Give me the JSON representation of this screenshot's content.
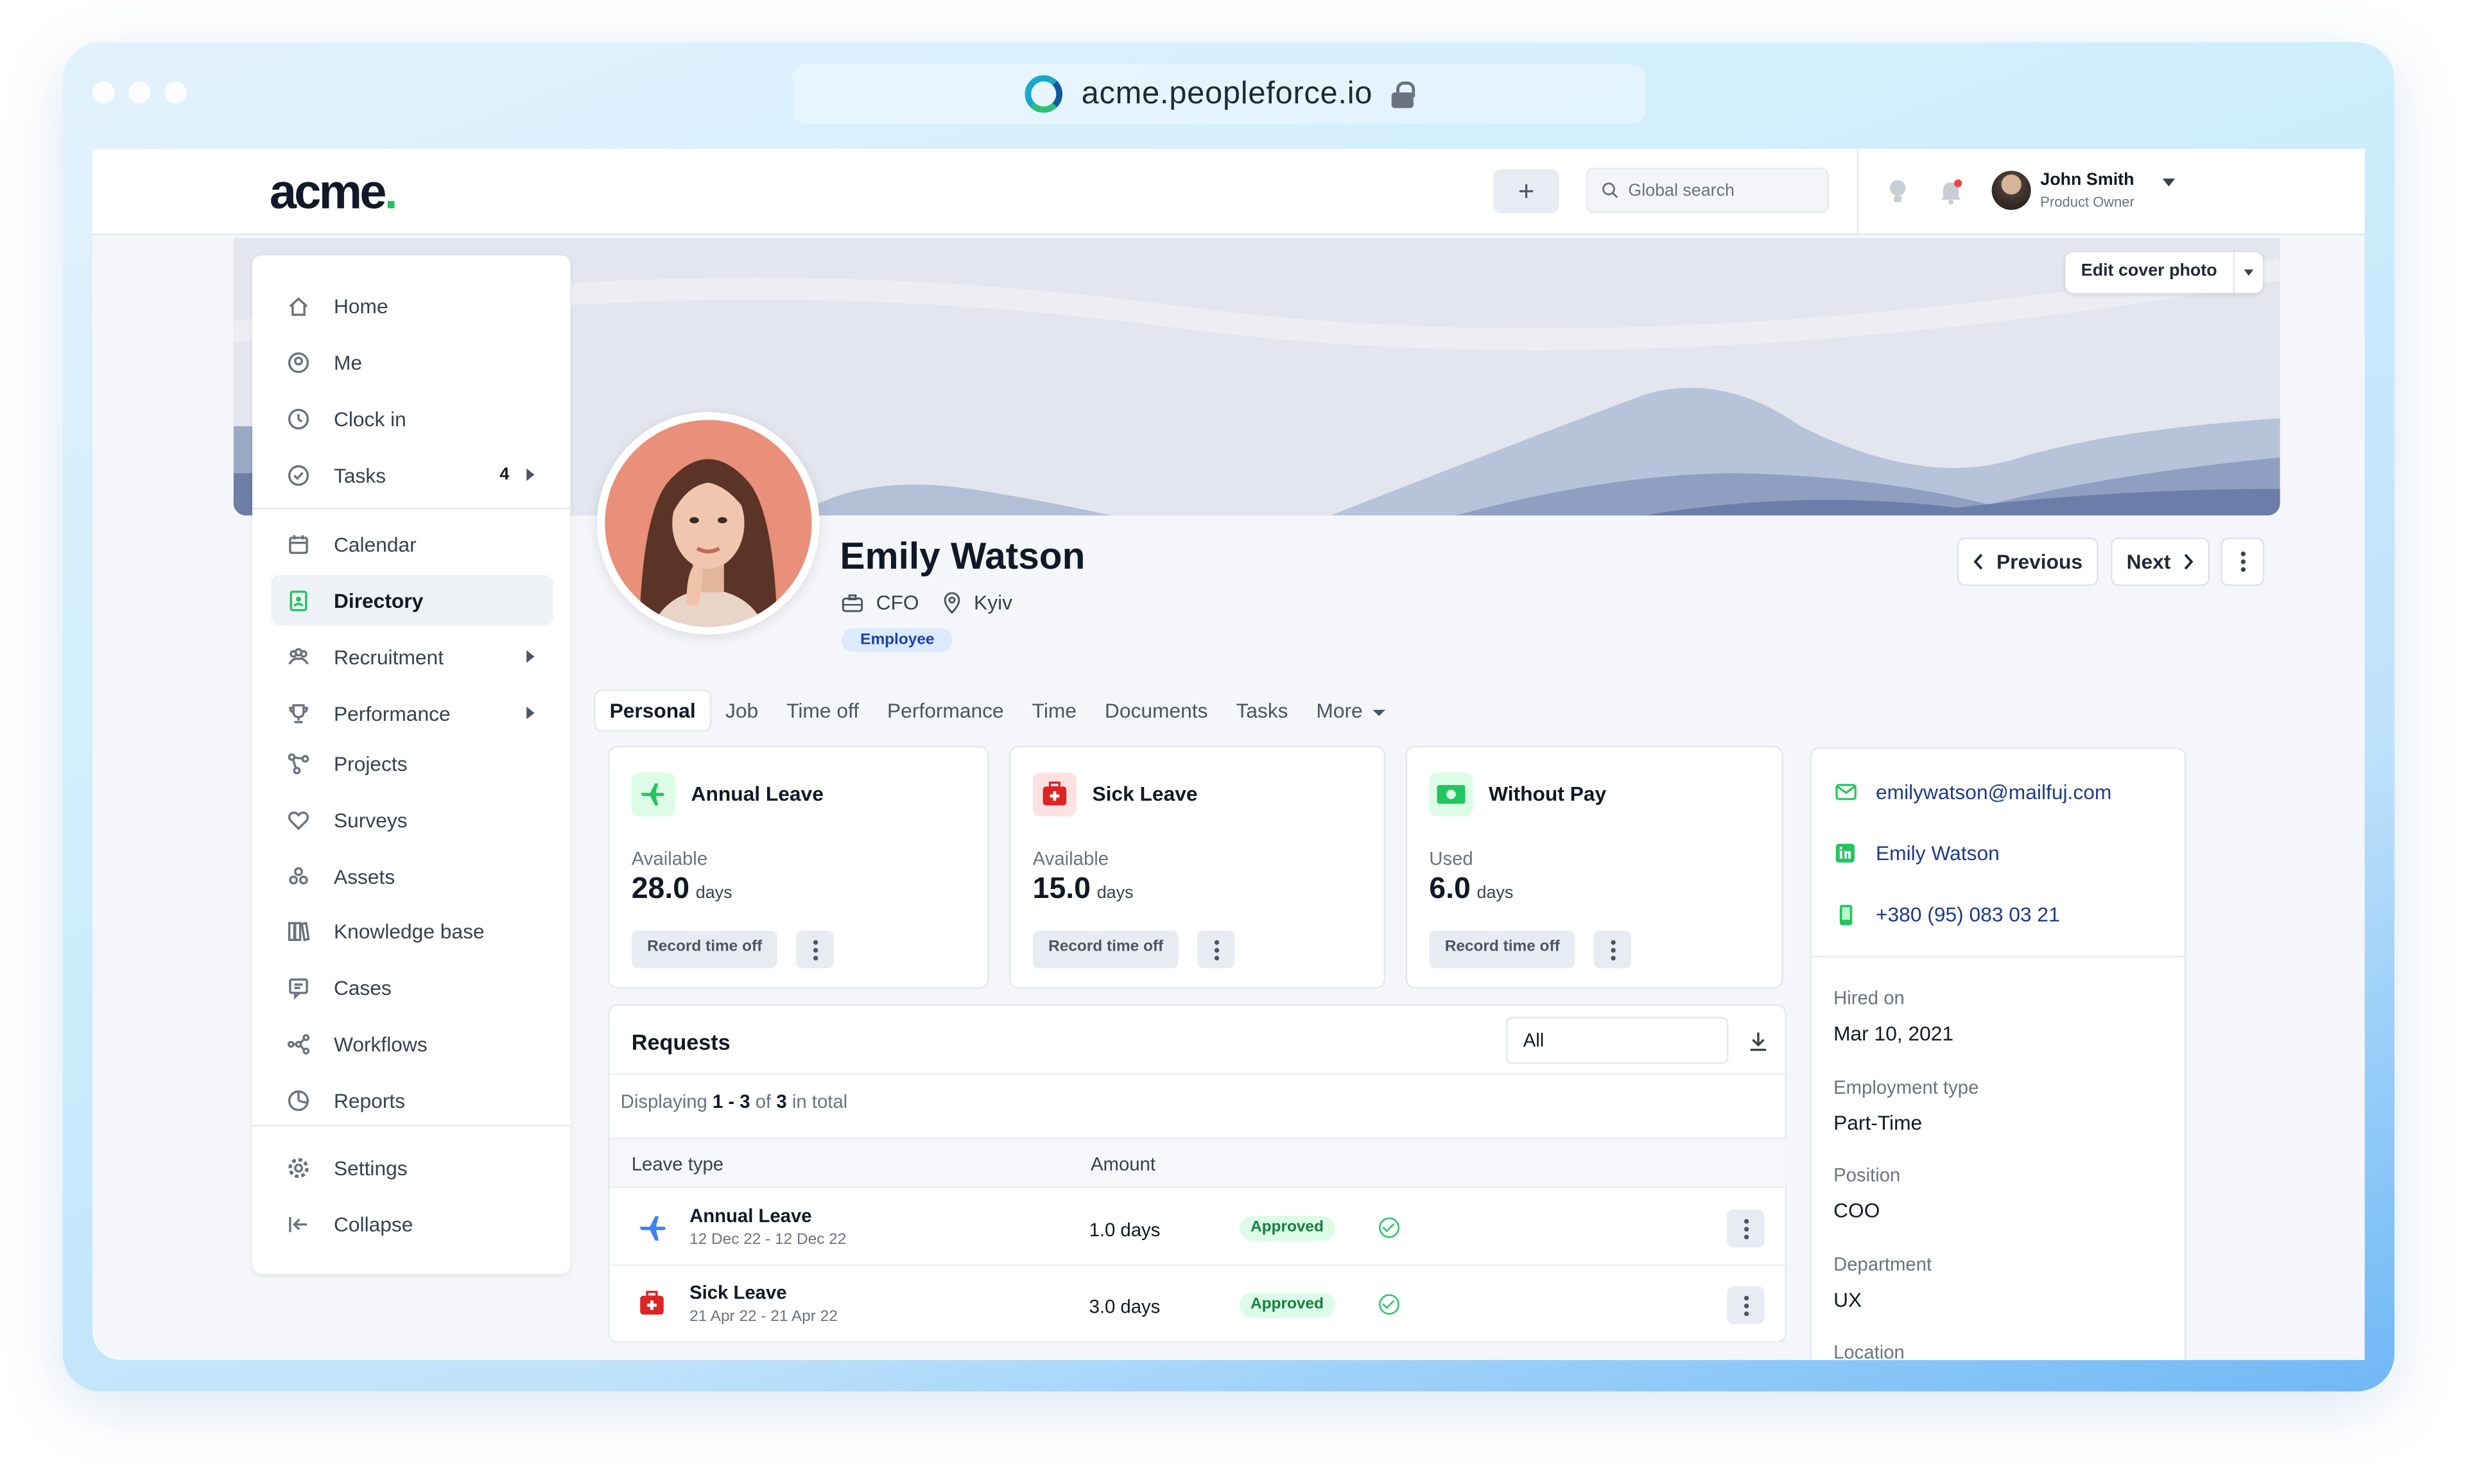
{
  "browser": {
    "url": "acme.peopleforce.io"
  },
  "topbar": {
    "brand": "acme",
    "brand_dot": ".",
    "add_label": "+",
    "search_placeholder": "Global search",
    "user": {
      "name": "John Smith",
      "role": "Product Owner"
    }
  },
  "cover": {
    "edit_label": "Edit cover photo"
  },
  "sidebar": {
    "items": [
      {
        "label": "Home",
        "icon": "home-icon"
      },
      {
        "label": "Me",
        "icon": "user-circle-icon"
      },
      {
        "label": "Clock in",
        "icon": "clock-icon"
      },
      {
        "label": "Tasks",
        "icon": "check-circle-icon",
        "badge": "4"
      },
      {
        "label": "Calendar",
        "icon": "calendar-icon"
      },
      {
        "label": "Directory",
        "icon": "directory-icon"
      },
      {
        "label": "Recruitment",
        "icon": "people-icon"
      },
      {
        "label": "Performance",
        "icon": "trophy-icon"
      },
      {
        "label": "Projects",
        "icon": "projects-icon"
      },
      {
        "label": "Surveys",
        "icon": "heart-icon"
      },
      {
        "label": "Assets",
        "icon": "assets-icon"
      },
      {
        "label": "Knowledge base",
        "icon": "books-icon"
      },
      {
        "label": "Cases",
        "icon": "chat-icon"
      },
      {
        "label": "Workflows",
        "icon": "workflow-icon"
      },
      {
        "label": "Reports",
        "icon": "pie-icon"
      },
      {
        "label": "Settings",
        "icon": "gear-icon"
      },
      {
        "label": "Collapse",
        "icon": "collapse-icon"
      }
    ]
  },
  "employee": {
    "name": "Emily Watson",
    "position": "CFO",
    "city": "Kyiv",
    "badge": "Employee",
    "prev_label": "Previous",
    "next_label": "Next"
  },
  "tabs": [
    "Personal",
    "Job",
    "Time off",
    "Performance",
    "Time",
    "Documents",
    "Tasks",
    "More"
  ],
  "leave_cards": [
    {
      "title": "Annual Leave",
      "sub": "Available",
      "value": "28.0",
      "unit": "days",
      "button": "Record time off",
      "color": "#22c55e"
    },
    {
      "title": "Sick Leave",
      "sub": "Available",
      "value": "15.0",
      "unit": "days",
      "button": "Record time off",
      "color": "#dc2626"
    },
    {
      "title": "Without Pay",
      "sub": "Used",
      "value": "6.0",
      "unit": "days",
      "button": "Record time off",
      "color": "#22c55e"
    }
  ],
  "requests": {
    "title": "Requests",
    "filter": "All",
    "displaying": "Displaying",
    "range": "1 - 3",
    "of": "of",
    "total": "3",
    "in_total": "in total",
    "columns": [
      "Leave type",
      "Amount"
    ],
    "rows": [
      {
        "type": "Annual Leave",
        "dates": "12 Dec 22 - 12 Dec 22",
        "amount": "1.0 days",
        "status": "Approved"
      },
      {
        "type": "Sick Leave",
        "dates": "21 Apr 22 - 21 Apr 22",
        "amount": "3.0 days",
        "status": "Approved"
      }
    ]
  },
  "contact": {
    "email": "emilywatson@mailfuj.com",
    "linkedin": "Emily Watson",
    "phone": "+380 (95) 083 03 21"
  },
  "info": [
    {
      "label": "Hired on",
      "value": "Mar 10, 2021"
    },
    {
      "label": "Employment type",
      "value": "Part-Time"
    },
    {
      "label": "Position",
      "value": "COO"
    },
    {
      "label": "Department",
      "value": "UX"
    },
    {
      "label": "Location",
      "value": ""
    }
  ]
}
